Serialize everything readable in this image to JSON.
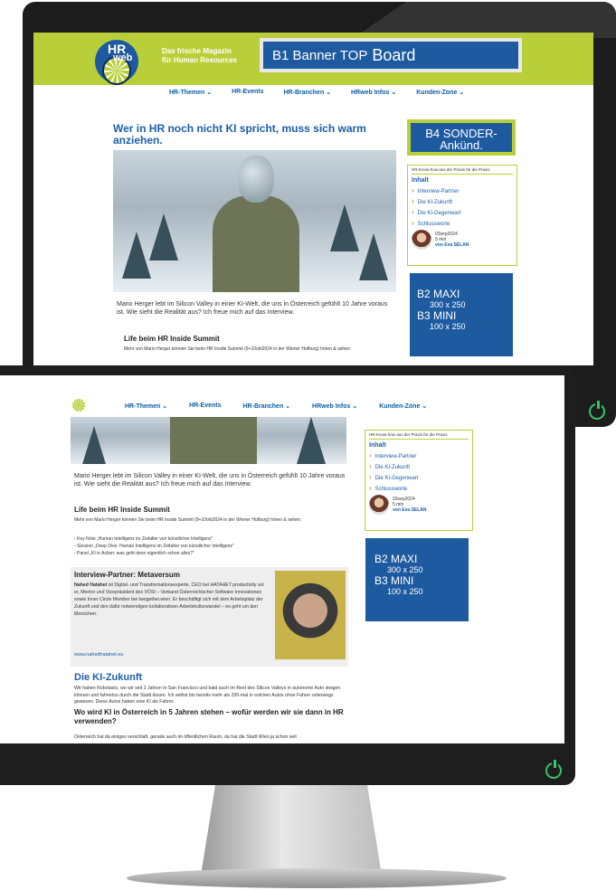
{
  "brand": {
    "logo_hr": "HR",
    "logo_web": "web",
    "tagline1": "Das frische Magazin",
    "tagline2": "für Human Resources"
  },
  "banners": {
    "b1_a": "B1 Banner TOP",
    "b1_b": "Board",
    "b4_a": "B4 SONDER-",
    "b4_b": "Ankünd.",
    "b2_a": "B2 MAXI",
    "b2_b": "300 x 250",
    "b3_a": "B3 MINI",
    "b3_b": "100 x 250"
  },
  "nav": [
    "HR-Themen ⌄",
    "HR-Events",
    "HR-Branchen ⌄",
    "HRweb Infos ⌄",
    "Kunden-Zone ⌄"
  ],
  "article": {
    "title": "Wer in HR noch nicht KI spricht, muss sich warm anziehen.",
    "lead": "Mario Herger lebt im Silicon Valley in einer KI-Welt, die uns in Österreich gefühlt 10 Jahre voraus ist. Wie sieht die Realität aus? Ich freue mich auf das Interview.",
    "h_summit": "Life beim HR Inside Summit",
    "summit_text": "Mehr von Mario Herger können Sie beim HR Inside Summit (9+10okt2024 in der Wiener Hofburg) hören & sehen:",
    "bullets": [
      "Key Note „Human Intelligenz im Zeitalter von künstlicher Intelligenz“",
      "Session „Deep Dive: Human Intelligenz im Zeitalter von künstlicher Intelligenz“",
      "Panel „KI in Action: was geht denn eigentlich schon alles?“"
    ],
    "partner_title": "Interview-Partner: Metaversum",
    "partner_name": "Nahed Hatahet",
    "partner_text": " ist Digital- und Transformationsexperte, CEO bei HATAHET productivity sol                                    er, Mentor und Vizepräsident des VÖSI – Verband Österreichischer Software Innovationen sowie Inner Circle Member bei twogether.wien. Er beschäftigt sich mit dem Arbeitsplatz der Zukunft und den dafür notwendigen kollaborativen Arbeitskulturwandel – es geht um den Menschen.",
    "partner_link": "www.nahedhatahet.eu",
    "h_zukunft": "Die KI-Zukunft",
    "zukunft_text": "Wir haben Robotaxis, wo wir seit 2 Jahren in San Francisco und bald auch im Rest des Silicon Valleys in autonome Auto steigen können und fahrerlos durch die Stadt düsen. Ich selbst bin bereits mehr als 200-mal in solchen Autos ohne Fahrer unterwegs gewesen. Diese Autos haben eine KI als Fahrer.",
    "h_q": "Wo wird KI in Österreich in 5 Jahren stehen – wofür werden wir sie dann in HR verwenden?",
    "q_text": "Österreich hat da einiges verschlaft, gerade auch im öffentlichen Raum, da hat die Stadt Wien ja schon seit"
  },
  "toc": {
    "header": "HR-Know-how aus der Praxis für die Praxis",
    "title": "Inhalt",
    "items": [
      "Interview-Partner",
      "Die KI-Zukunft",
      "Die KI-Gegenwart",
      "Schlussworte"
    ],
    "date": "03sep2024",
    "read": "5 min",
    "author": "von Eva SELAN"
  },
  "colors": {
    "accent": "#b8cf3a",
    "brand_blue": "#1e5aa0",
    "link_blue": "#1a5fa8"
  },
  "icons": [
    "power-icon",
    "chevron-down-icon",
    "lemon-logo-icon"
  ]
}
